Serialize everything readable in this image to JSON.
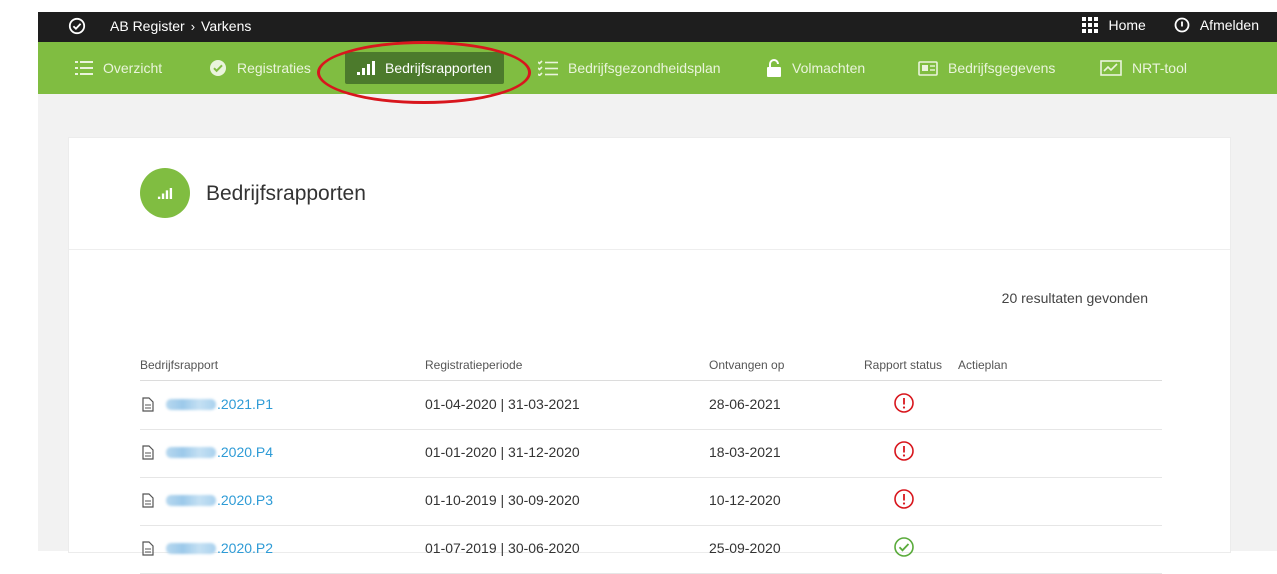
{
  "colors": {
    "accent_green": "#80bd41",
    "active_green": "#4c7a2c",
    "topbar": "#1e1e1e",
    "link_blue": "#2e9bd6",
    "status_warning": "#d8161d",
    "status_ok": "#5aab3b"
  },
  "topbar": {
    "breadcrumb": [
      "AB Register",
      "Varkens"
    ],
    "home_label": "Home",
    "logout_label": "Afmelden",
    "icons": [
      "check-circle-icon",
      "grid-icon",
      "power-icon"
    ]
  },
  "nav": {
    "items": [
      {
        "label": "Overzicht",
        "icon": "list-icon"
      },
      {
        "label": "Registraties",
        "icon": "check-circle-icon"
      },
      {
        "label": "Bedrijfsrapporten",
        "icon": "bar-signal-icon",
        "active": true
      },
      {
        "label": "Bedrijfsgezondheidsplan",
        "icon": "checklist-icon"
      },
      {
        "label": "Volmachten",
        "icon": "padlock-icon"
      },
      {
        "label": "Bedrijfsgegevens",
        "icon": "id-card-icon"
      },
      {
        "label": "NRT-tool",
        "icon": "chart-line-icon"
      }
    ]
  },
  "page": {
    "title": "Bedrijfsrapporten",
    "result_count": "20 resultaten gevonden"
  },
  "table": {
    "headers": [
      "Bedrijfsrapport",
      "Registratieperiode",
      "Ontvangen op",
      "Rapport status",
      "Actieplan"
    ],
    "rows": [
      {
        "code_suffix": ".2021.P1",
        "period": "01-04-2020 | 31-03-2021",
        "received": "28-06-2021",
        "status": "warning"
      },
      {
        "code_suffix": ".2020.P4",
        "period": "01-01-2020 | 31-12-2020",
        "received": "18-03-2021",
        "status": "warning"
      },
      {
        "code_suffix": ".2020.P3",
        "period": "01-10-2019 | 30-09-2020",
        "received": "10-12-2020",
        "status": "warning"
      },
      {
        "code_suffix": ".2020.P2",
        "period": "01-07-2019 | 30-06-2020",
        "received": "25-09-2020",
        "status": "ok"
      }
    ]
  }
}
